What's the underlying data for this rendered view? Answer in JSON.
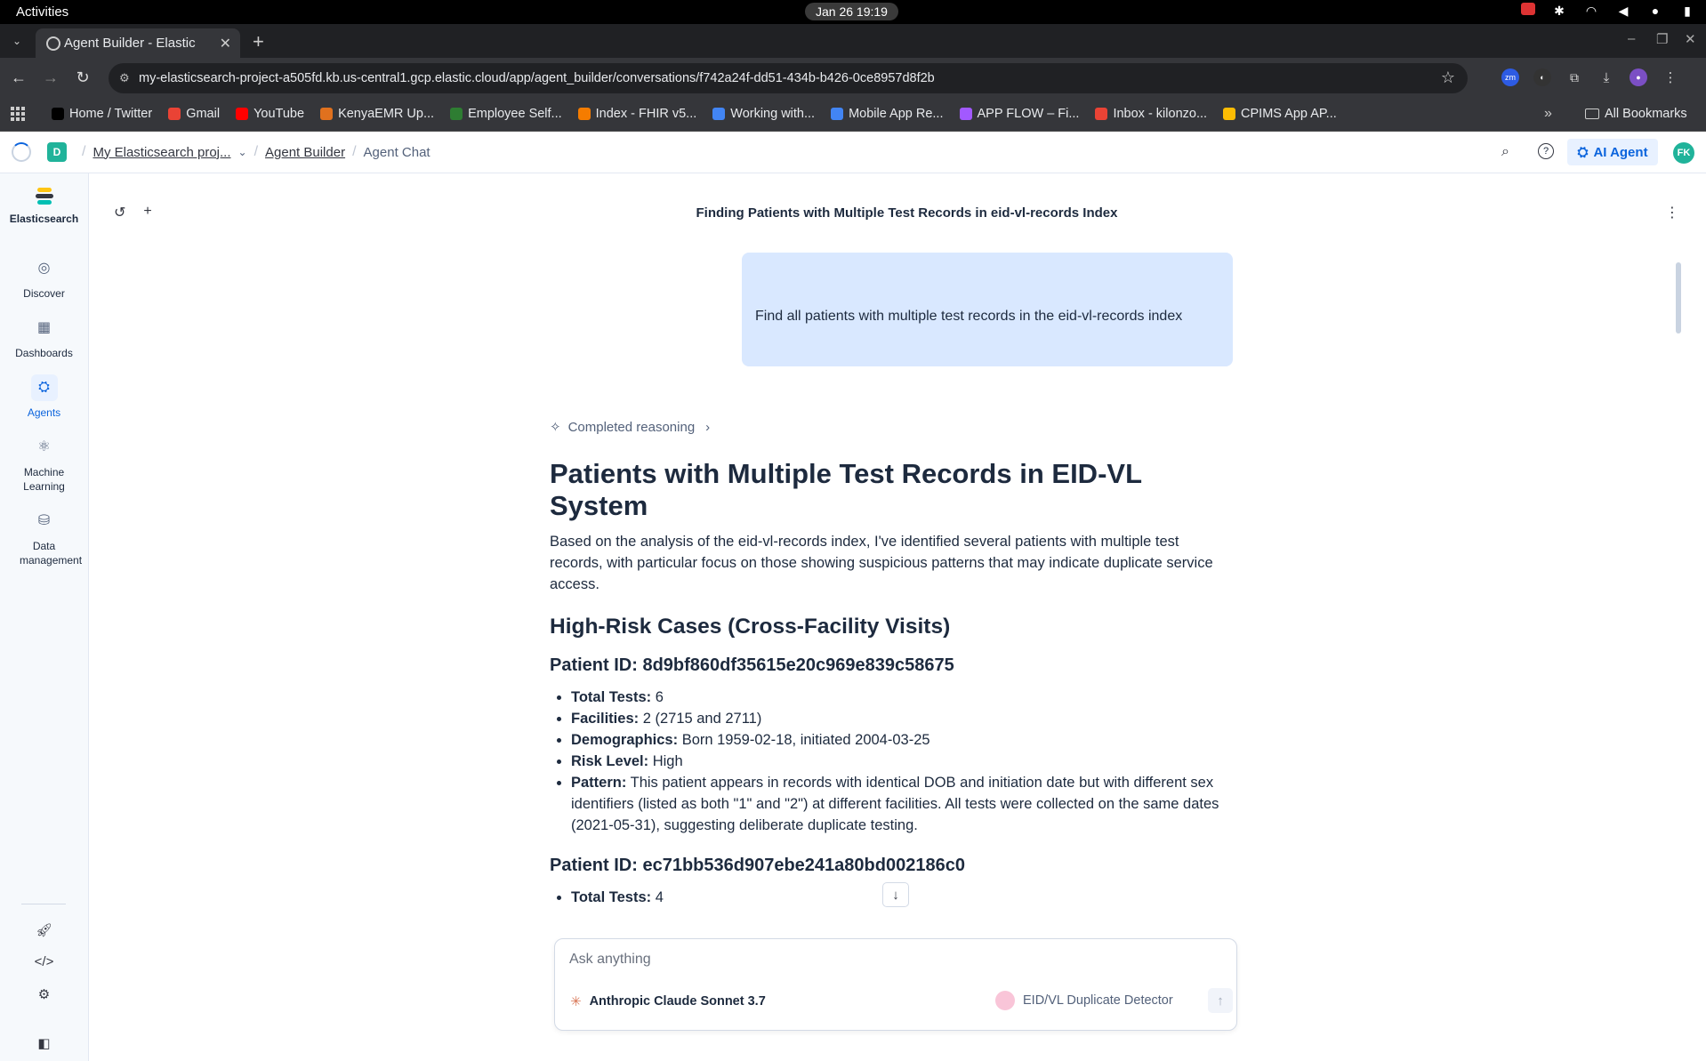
{
  "os": {
    "activities": "Activities",
    "clock": "Jan 26  19:19"
  },
  "browser": {
    "tab_title": "Agent Builder - Elastic",
    "url": "my-elasticsearch-project-a505fd.kb.us-central1.gcp.elastic.cloud/app/agent_builder/conversations/f742a24f-dd51-434b-b426-0ce8957d8f2b",
    "bookmarks": [
      {
        "label": "Home / Twitter",
        "color": "#000000"
      },
      {
        "label": "Gmail",
        "color": "#ea4335"
      },
      {
        "label": "YouTube",
        "color": "#ff0000"
      },
      {
        "label": "KenyaEMR Up...",
        "color": "#e0711e"
      },
      {
        "label": "Employee Self...",
        "color": "#2e7d32"
      },
      {
        "label": "Index - FHIR v5...",
        "color": "#f57c00"
      },
      {
        "label": "Working with...",
        "color": "#4285f4"
      },
      {
        "label": "Mobile App Re...",
        "color": "#4285f4"
      },
      {
        "label": "APP FLOW – Fi...",
        "color": "#a259ff"
      },
      {
        "label": "Inbox - kilonzo...",
        "color": "#ea4335"
      },
      {
        "label": "CPIMS App AP...",
        "color": "#fbbc04"
      }
    ],
    "all_bookmarks": "All Bookmarks"
  },
  "kibana": {
    "space_initial": "D",
    "breadcrumbs": [
      "My Elasticsearch proj...",
      "Agent Builder",
      "Agent Chat"
    ],
    "ai_agent_label": "AI Agent",
    "user_initials": "FK"
  },
  "sidenav": {
    "logo_label": "Elasticsearch",
    "items": [
      {
        "label": "Discover"
      },
      {
        "label": "Dashboards"
      },
      {
        "label": "Agents"
      },
      {
        "label": "Machine Learning"
      },
      {
        "label": "Data management"
      }
    ]
  },
  "conversation": {
    "title": "Finding Patients with Multiple Test Records in eid-vl-records Index",
    "user_message": "Find all patients with multiple test records in the eid-vl-records index",
    "reasoning_label": "Completed reasoning",
    "answer": {
      "heading": "Patients with Multiple Test Records in EID-VL System",
      "intro": "Based on the analysis of the eid-vl-records index, I've identified several patients with multiple test records, with particular focus on those showing suspicious patterns that may indicate duplicate service access.",
      "section_heading": "High-Risk Cases (Cross-Facility Visits)",
      "patient1": {
        "heading": "Patient ID: 8d9bf860df35615e20c969e839c58675",
        "items": [
          {
            "label": "Total Tests:",
            "value": " 6"
          },
          {
            "label": "Facilities:",
            "value": " 2 (2715 and 2711)"
          },
          {
            "label": "Demographics:",
            "value": " Born 1959-02-18, initiated 2004-03-25"
          },
          {
            "label": "Risk Level:",
            "value": " High"
          },
          {
            "label": "Pattern:",
            "value": " This patient appears in records with identical DOB and initiation date but with different sex identifiers (listed as both \"1\" and \"2\") at different facilities. All tests were collected on the same dates (2021-05-31), suggesting deliberate duplicate testing."
          }
        ]
      },
      "patient2": {
        "heading": "Patient ID: ec71bb536d907ebe241a80bd002186c0",
        "items": [
          {
            "label": "Total Tests:",
            "value": " 4"
          }
        ]
      }
    }
  },
  "composer": {
    "placeholder": "Ask anything",
    "model": "Anthropic Claude Sonnet 3.7",
    "agent": "EID/VL Duplicate Detector"
  },
  "colors": {
    "accent": "#0b64dd",
    "user_bubble": "#d9e8ff",
    "space_badge": "#20b39a"
  }
}
